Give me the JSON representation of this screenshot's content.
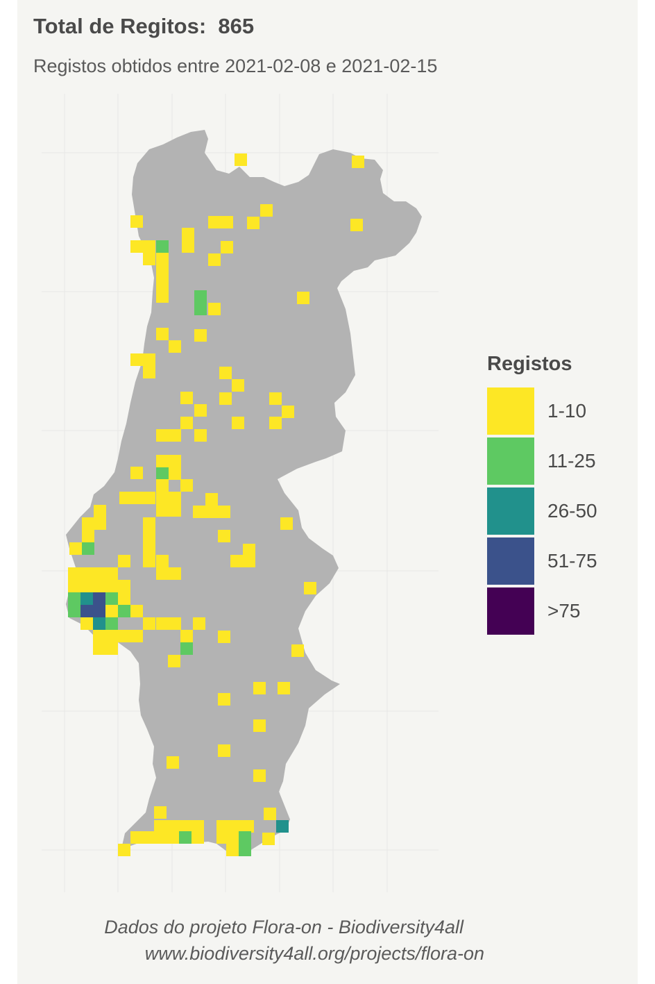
{
  "title": "Total de Regitos:  865",
  "subtitle": "Registos obtidos entre 2021-02-08 e 2021-02-15",
  "legend": {
    "title": "Registos",
    "items": [
      {
        "label": "1-10",
        "color": "#fde725"
      },
      {
        "label": "11-25",
        "color": "#5ec962"
      },
      {
        "label": "26-50",
        "color": "#21918c"
      },
      {
        "label": "51-75",
        "color": "#3b528b"
      },
      {
        "label": ">75",
        "color": "#440154"
      }
    ]
  },
  "caption": {
    "line1": "Dados do projeto Flora-on - Biodiversity4all",
    "line2": "www.biodiversity4all.org/projects/flora-on"
  },
  "map": {
    "land_color": "#b3b3b3",
    "grid_color": "#e8e8e6"
  }
}
